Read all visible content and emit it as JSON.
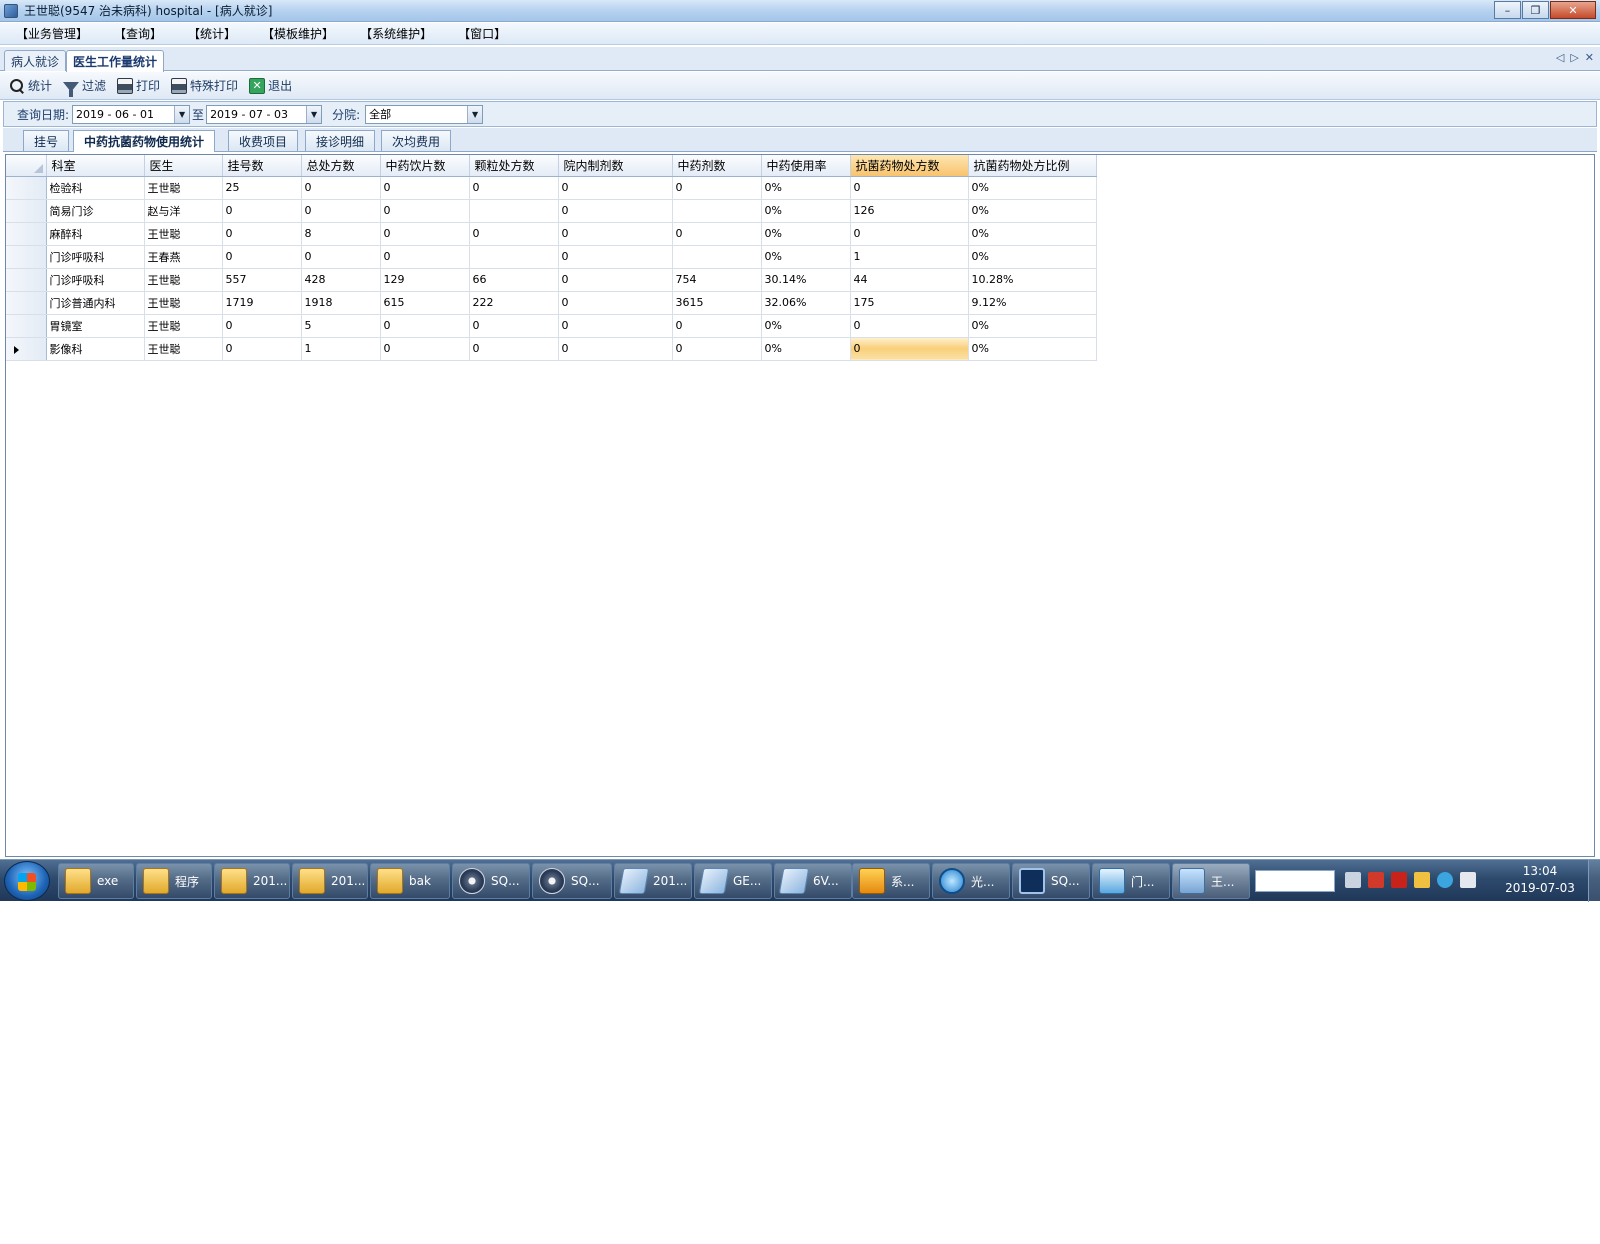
{
  "window": {
    "title": "王世聪(9547 治未病科) hospital - [病人就诊]",
    "controls": {
      "minimize": "–",
      "maximize": "❐",
      "close": "✕"
    }
  },
  "menu": [
    "【业务管理】",
    "【查询】",
    "【统计】",
    "【模板维护】",
    "【系统维护】",
    "【窗口】"
  ],
  "doc_tabs": {
    "items": [
      "病人就诊",
      "医生工作量统计"
    ],
    "active_index": 1,
    "nav": {
      "prev": "◁",
      "next": "▷",
      "close": "✕"
    }
  },
  "toolbar": {
    "stat": "统计",
    "filter": "过滤",
    "print": "打印",
    "special_print": "特殊打印",
    "exit": "退出"
  },
  "filters": {
    "date_label": "查询日期:",
    "date_from": "2019 - 06 - 01",
    "to_label": "至",
    "date_to": "2019 - 07 - 03",
    "branch_label": "分院:",
    "branch_value": "全部",
    "drop_glyph": "▼"
  },
  "sub_tabs": {
    "items": [
      "挂号",
      "中药抗菌药物使用统计",
      "收费项目",
      "接诊明细",
      "次均费用"
    ],
    "active_index": 1
  },
  "grid": {
    "columns": [
      "科室",
      "医生",
      "挂号数",
      "总处方数",
      "中药饮片数",
      "颗粒处方数",
      "院内制剂数",
      "中药剂数",
      "中药使用率",
      "抗菌药物处方数",
      "抗菌药物处方比例"
    ],
    "selected_column": 9,
    "current_row": 7,
    "rows": [
      [
        "检验科",
        "王世聪",
        "25",
        "0",
        "0",
        "0",
        "0",
        "0",
        "0%",
        "0",
        "0%"
      ],
      [
        "简易门诊",
        "赵与洋",
        "0",
        "0",
        "0",
        "",
        "0",
        "",
        "0%",
        "126",
        "0%"
      ],
      [
        "麻醉科",
        "王世聪",
        "0",
        "8",
        "0",
        "0",
        "0",
        "0",
        "0%",
        "0",
        "0%"
      ],
      [
        "门诊呼吸科",
        "王春燕",
        "0",
        "0",
        "0",
        "",
        "0",
        "",
        "0%",
        "1",
        "0%"
      ],
      [
        "门诊呼吸科",
        "王世聪",
        "557",
        "428",
        "129",
        "66",
        "0",
        "754",
        "30.14%",
        "44",
        "10.28%"
      ],
      [
        "门诊普通内科",
        "王世聪",
        "1719",
        "1918",
        "615",
        "222",
        "0",
        "3615",
        "32.06%",
        "175",
        "9.12%"
      ],
      [
        "胃镜室",
        "王世聪",
        "0",
        "5",
        "0",
        "0",
        "0",
        "0",
        "0%",
        "0",
        "0%"
      ],
      [
        "影像科",
        "王世聪",
        "0",
        "1",
        "0",
        "0",
        "0",
        "0",
        "0%",
        "0",
        "0%"
      ]
    ]
  },
  "taskbar": {
    "items": [
      {
        "label": "exe",
        "icon": "folder-icon"
      },
      {
        "label": "程序",
        "icon": "folder-icon"
      },
      {
        "label": "201...",
        "icon": "folder-icon"
      },
      {
        "label": "201...",
        "icon": "folder-icon"
      },
      {
        "label": "bak",
        "icon": "folder-icon"
      },
      {
        "label": "SQ...",
        "icon": "compass-icon"
      },
      {
        "label": "SQ...",
        "icon": "compass-icon"
      },
      {
        "label": "201...",
        "icon": "notepad-icon"
      },
      {
        "label": "GE...",
        "icon": "notepad-icon"
      },
      {
        "label": "6V...",
        "icon": "notepad-icon"
      },
      {
        "label": "系...",
        "icon": "sql-icon"
      },
      {
        "label": "光...",
        "icon": "search-icon"
      },
      {
        "label": "SQ...",
        "icon": "sql-magnifier-icon"
      },
      {
        "label": "门...",
        "icon": "printer-icon"
      },
      {
        "label": "王...",
        "icon": "person-icon"
      }
    ],
    "clock_time": "13:04",
    "clock_date": "2019-07-03"
  }
}
